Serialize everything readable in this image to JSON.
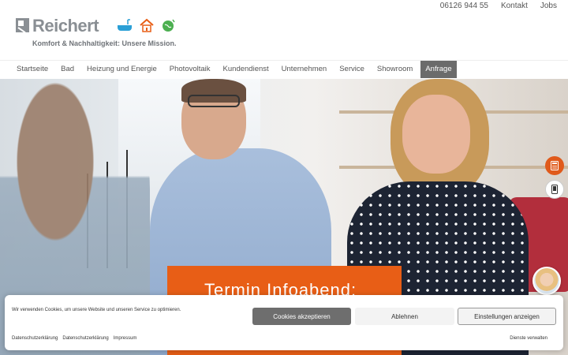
{
  "utility": {
    "phone": "06126 944 55",
    "contact": "Kontakt",
    "jobs": "Jobs"
  },
  "logo": {
    "word": "Reichert",
    "tagline": "Komfort & Nachhaltigkeit: Unsere Mission."
  },
  "nav": {
    "items": [
      "Startseite",
      "Bad",
      "Heizung und Energie",
      "Photovoltaik",
      "Kundendienst",
      "Unternehmen",
      "Service",
      "Showroom",
      "Anfrage"
    ],
    "active": "Anfrage"
  },
  "hero": {
    "promo_title": "Termin Infoabend:"
  },
  "side_buttons": {
    "calculator": "calculator-icon",
    "phone": "smartphone-icon"
  },
  "cookie": {
    "message": "Wir verwenden Cookies, um unsere Website und unseren Service zu optimieren.",
    "accept_label": "Cookies akzeptieren",
    "deny_label": "Ablehnen",
    "settings_label": "Einstellungen anzeigen",
    "links": [
      "Datenschutzerklärung",
      "Datenschutzerklärung",
      "Impressum"
    ],
    "manage_label": "Dienste verwalten"
  },
  "colors": {
    "brand_gray": "#8a8f94",
    "accent_orange": "#e85e16",
    "nav_active": "#6b6b6b"
  }
}
